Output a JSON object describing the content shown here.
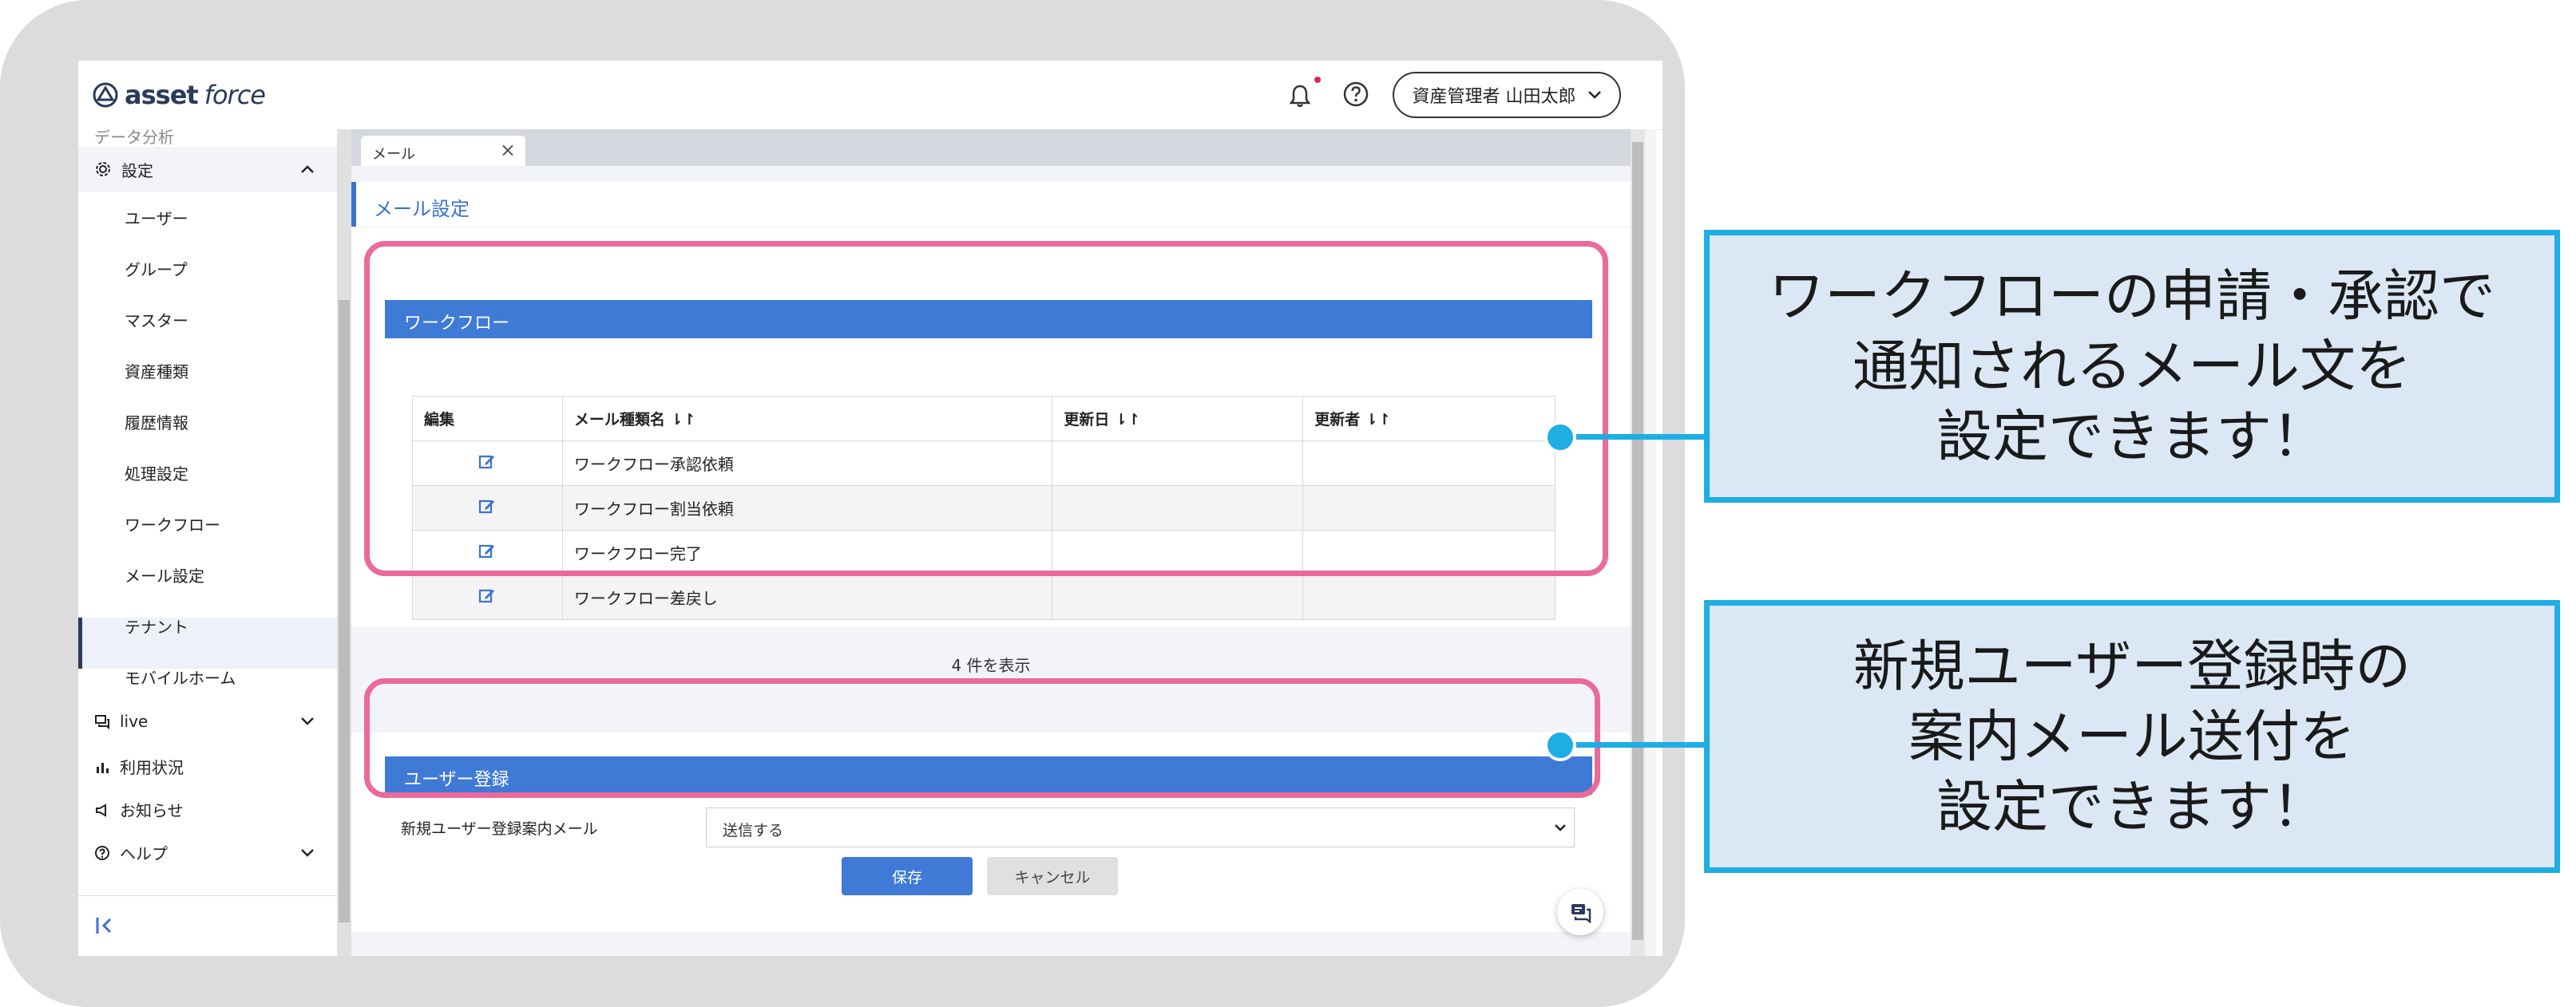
{
  "header": {
    "logo_bold": "asset",
    "logo_regular": "force",
    "user_label": "資産管理者 山田太郎"
  },
  "sidebar": {
    "partial_item": "データ分析",
    "group_label": "設定",
    "items": [
      {
        "label": "ユーザー"
      },
      {
        "label": "グループ"
      },
      {
        "label": "マスター"
      },
      {
        "label": "資産種類"
      },
      {
        "label": "履歴情報"
      },
      {
        "label": "処理設定"
      },
      {
        "label": "ワークフロー"
      },
      {
        "label": "メール設定"
      },
      {
        "label": "テナント"
      },
      {
        "label": "モバイルホーム"
      }
    ],
    "bottom": {
      "live": "live",
      "usage": "利用状況",
      "notice": "お知らせ",
      "help": "ヘルプ"
    }
  },
  "tab": {
    "label": "メール"
  },
  "page": {
    "title": "メール設定"
  },
  "workflow": {
    "section_title": "ワークフロー",
    "columns": [
      "編集",
      "メール種類名 ⇂↾",
      "更新日 ⇂↾",
      "更新者 ⇂↾"
    ],
    "rows": [
      {
        "name": "ワークフロー承認依頼",
        "updated": "",
        "updater": ""
      },
      {
        "name": "ワークフロー割当依頼",
        "updated": "",
        "updater": ""
      },
      {
        "name": "ワークフロー完了",
        "updated": "",
        "updater": ""
      },
      {
        "name": "ワークフロー差戻し",
        "updated": "",
        "updater": ""
      }
    ],
    "count": "4 件を表示"
  },
  "user_registration": {
    "section_title": "ユーザー登録",
    "field_label": "新規ユーザー登録案内メール",
    "field_value": "送信する"
  },
  "buttons": {
    "save": "保存",
    "cancel": "キャンセル"
  },
  "callouts": {
    "top": [
      "ワークフローの申請・承認で",
      "通知されるメール文を",
      "設定できます！"
    ],
    "bottom": [
      "新規ユーザー登録時の",
      "案内メール送付を",
      "設定できます！"
    ]
  },
  "colors": {
    "highlight": "#ea6a9c",
    "callout_border": "#1eaee4",
    "callout_fill": "#dbe7f5",
    "section_bar": "#3f7ad6"
  }
}
